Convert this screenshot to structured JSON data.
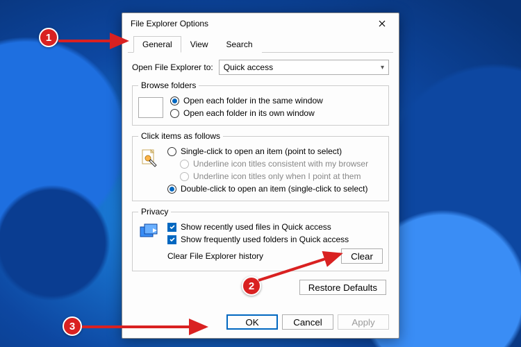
{
  "window": {
    "title": "File Explorer Options"
  },
  "tabs": {
    "general": "General",
    "view": "View",
    "search": "Search"
  },
  "open_row": {
    "label": "Open File Explorer to:",
    "value": "Quick access"
  },
  "browse": {
    "legend": "Browse folders",
    "same": "Open each folder in the same window",
    "own": "Open each folder in its own window"
  },
  "click": {
    "legend": "Click items as follows",
    "single": "Single-click to open an item (point to select)",
    "underline_browser": "Underline icon titles consistent with my browser",
    "underline_point": "Underline icon titles only when I point at them",
    "double": "Double-click to open an item (single-click to select)"
  },
  "privacy": {
    "legend": "Privacy",
    "recent_files": "Show recently used files in Quick access",
    "frequent_folders": "Show frequently used folders in Quick access",
    "clear_label": "Clear File Explorer history",
    "clear_btn": "Clear"
  },
  "buttons": {
    "restore": "Restore Defaults",
    "ok": "OK",
    "cancel": "Cancel",
    "apply": "Apply"
  },
  "annotations": {
    "b1": "1",
    "b2": "2",
    "b3": "3"
  }
}
